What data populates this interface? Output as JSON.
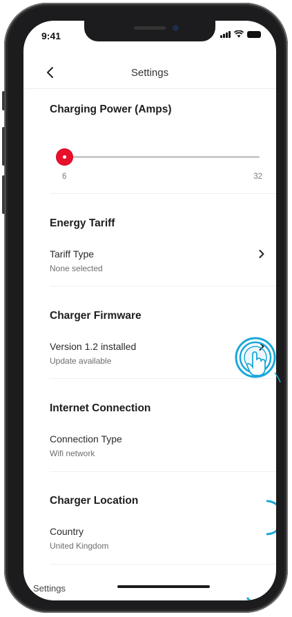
{
  "status_bar": {
    "time": "9:41"
  },
  "header": {
    "title": "Settings"
  },
  "charging_power": {
    "title": "Charging Power (Amps)",
    "slider": {
      "min": "6",
      "max": "32",
      "value": 6
    }
  },
  "energy_tariff": {
    "title": "Energy Tariff",
    "row": {
      "label": "Tariff Type",
      "value": "None selected"
    }
  },
  "charger_firmware": {
    "title": "Charger Firmware",
    "row": {
      "label": "Version 1.2 installed",
      "value": "Update available"
    }
  },
  "internet_connection": {
    "title": "Internet Connection",
    "row": {
      "label": "Connection Type",
      "value": "Wifi network"
    }
  },
  "charger_location": {
    "title": "Charger Location",
    "row": {
      "label": "Country",
      "value": "United Kingdom"
    }
  },
  "bottom": {
    "label": "Settings"
  },
  "colors": {
    "accent": "#e8102b",
    "tap_highlight": "#1aa7d8"
  },
  "icons": [
    "back-chevron-icon",
    "chevron-right-icon",
    "tap-gesture-icon",
    "signal-icon",
    "wifi-icon",
    "battery-icon"
  ]
}
